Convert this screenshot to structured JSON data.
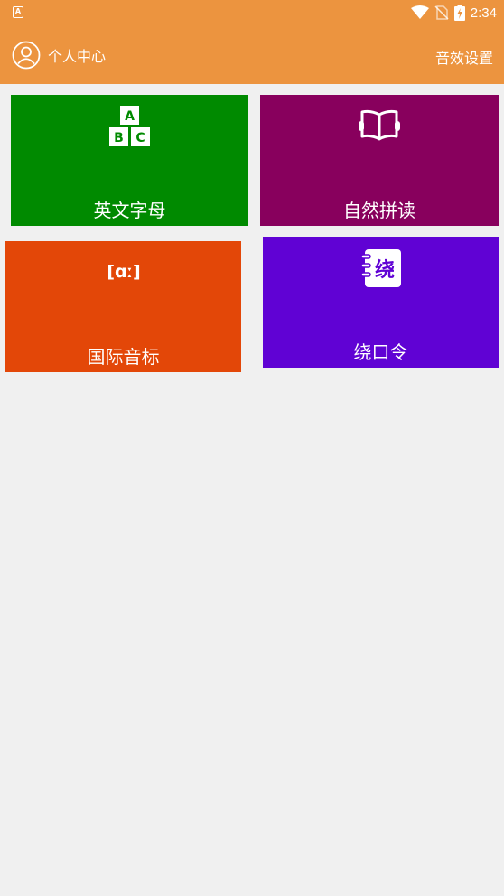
{
  "status_bar": {
    "notification_glyph": "A",
    "time": "2:34"
  },
  "app_bar": {
    "user_center_label": "个人中心",
    "sound_settings_label": "音效设置"
  },
  "tiles": [
    {
      "label": "英文字母",
      "color": "#008a00",
      "icon": "abc-blocks-icon",
      "icon_letters": [
        "A",
        "B",
        "C"
      ]
    },
    {
      "label": "自然拼读",
      "color": "#88005d",
      "icon": "open-book-icon"
    },
    {
      "label": "国际音标",
      "color": "#e34708",
      "icon": "phonetic-icon",
      "icon_text": "[ɑː]"
    },
    {
      "label": "绕口令",
      "color": "#6002d4",
      "icon": "notebook-icon",
      "icon_text": "绕"
    }
  ],
  "colors": {
    "header": "#ec943f",
    "background": "#f0f0f0"
  }
}
